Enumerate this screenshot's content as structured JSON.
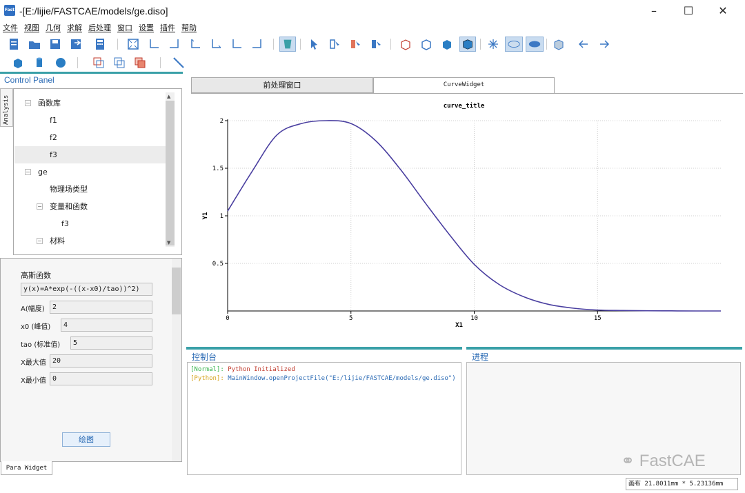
{
  "window": {
    "title": "-[E:/lijie/FASTCAE/models/ge.diso]",
    "icon_text": "Fast CAE"
  },
  "menu": [
    "文件",
    "视图",
    "几何",
    "求解",
    "后处理",
    "窗口",
    "设置",
    "插件",
    "帮助"
  ],
  "left_dock": {
    "title": "Control Panel",
    "side_tab": "Analysis",
    "tree": [
      {
        "label": "函数库",
        "toggle": "−"
      },
      {
        "label": "f1"
      },
      {
        "label": "f2"
      },
      {
        "label": "f3"
      },
      {
        "label": "ge",
        "toggle": "−"
      },
      {
        "label": "物理场类型"
      },
      {
        "label": "变量和函数",
        "toggle": "−"
      },
      {
        "label": "f3"
      },
      {
        "label": "材料",
        "toggle": "−"
      }
    ]
  },
  "params": {
    "heading": "高斯函数",
    "formula": "y(x)=A*exp(-((x-x0)/tao))^2)",
    "fields": [
      {
        "label": "A(幅度)",
        "value": "2"
      },
      {
        "label": "x0 (峰值)",
        "value": "4"
      },
      {
        "label": "tao (标准值)",
        "value": "5"
      },
      {
        "label": "X最大值",
        "value": "20"
      },
      {
        "label": "X最小值",
        "value": "0"
      }
    ],
    "plot_button": "绘图",
    "bottom_tab": "Para Widget"
  },
  "tabs": [
    "前处理窗口",
    "CurveWidget"
  ],
  "chart_data": {
    "type": "line",
    "title": "curve_title",
    "xlabel": "X1",
    "ylabel": "Y1",
    "xlim": [
      0,
      20
    ],
    "ylim": [
      0,
      2
    ],
    "x_ticks": [
      0,
      5,
      10,
      15
    ],
    "y_ticks": [
      0.5,
      1,
      1.5,
      2
    ],
    "grid": true,
    "series": [
      {
        "color": "#4a3fa0",
        "x": [
          0,
          1,
          2,
          3,
          4,
          5,
          6,
          7,
          8,
          9,
          10,
          11,
          12,
          13,
          14,
          15,
          16,
          17,
          18,
          19,
          20
        ],
        "y": [
          1.05,
          1.47,
          1.85,
          1.97,
          2.0,
          1.97,
          1.79,
          1.49,
          1.14,
          0.8,
          0.49,
          0.28,
          0.15,
          0.07,
          0.03,
          0.01,
          0.005,
          0.002,
          0.001,
          0.0,
          0.0
        ]
      }
    ]
  },
  "console": {
    "title": "控制台",
    "lines": [
      {
        "tag": "[Normal]:",
        "text": "Python Initialized",
        "tag_color": "#34b34a",
        "text_color": "#c0392b"
      },
      {
        "tag": "[Python]:",
        "text": "MainWindow.openProjectFile(\"E:/lijie/FASTCAE/models/ge.diso\")",
        "tag_color": "#d4a017",
        "text_color": "#2a6ab4"
      }
    ]
  },
  "progress": {
    "title": "进程"
  },
  "status": {
    "text": "画布 21.8011mm * 5.23136mm"
  },
  "watermark": "FastCAE"
}
